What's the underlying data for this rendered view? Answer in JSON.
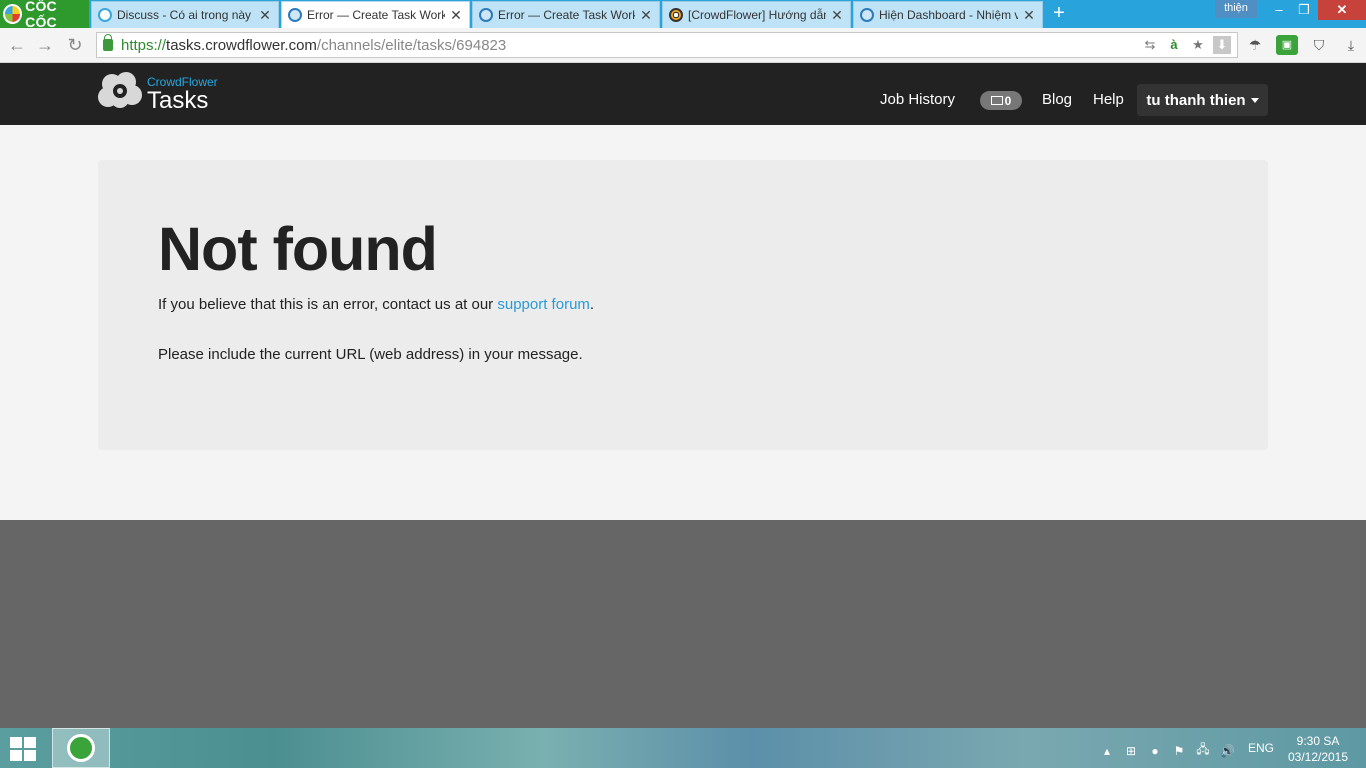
{
  "browser": {
    "brand": "CỐC CỐC",
    "tabs": [
      {
        "title": "Discuss - Có ai trong này l",
        "active": false
      },
      {
        "title": "Error — Create Task Work",
        "active": true
      },
      {
        "title": "Error — Create Task Work",
        "active": false
      },
      {
        "title": "[CrowdFlower] Hướng dẫn",
        "active": false
      },
      {
        "title": "Hiện Dashboard - Nhiệm v",
        "active": false
      }
    ],
    "profile_name": "thiện",
    "url_scheme": "https://",
    "url_host": "tasks.crowdflower.com",
    "url_path": "/channels/elite/tasks/694823"
  },
  "site": {
    "logo_small": "CrowdFlower",
    "logo_big": "Tasks",
    "nav": {
      "job_history": "Job History",
      "messages_count": "0",
      "blog": "Blog",
      "help": "Help",
      "user": "tu thanh thien"
    }
  },
  "error": {
    "title": "Not found",
    "line1_prefix": "If you believe that this is an error, contact us at our ",
    "line1_link": "support forum",
    "line1_suffix": ".",
    "line2": "Please include the current URL (web address) in your message."
  },
  "taskbar": {
    "language": "ENG",
    "time": "9:30 SA",
    "date": "03/12/2015"
  }
}
